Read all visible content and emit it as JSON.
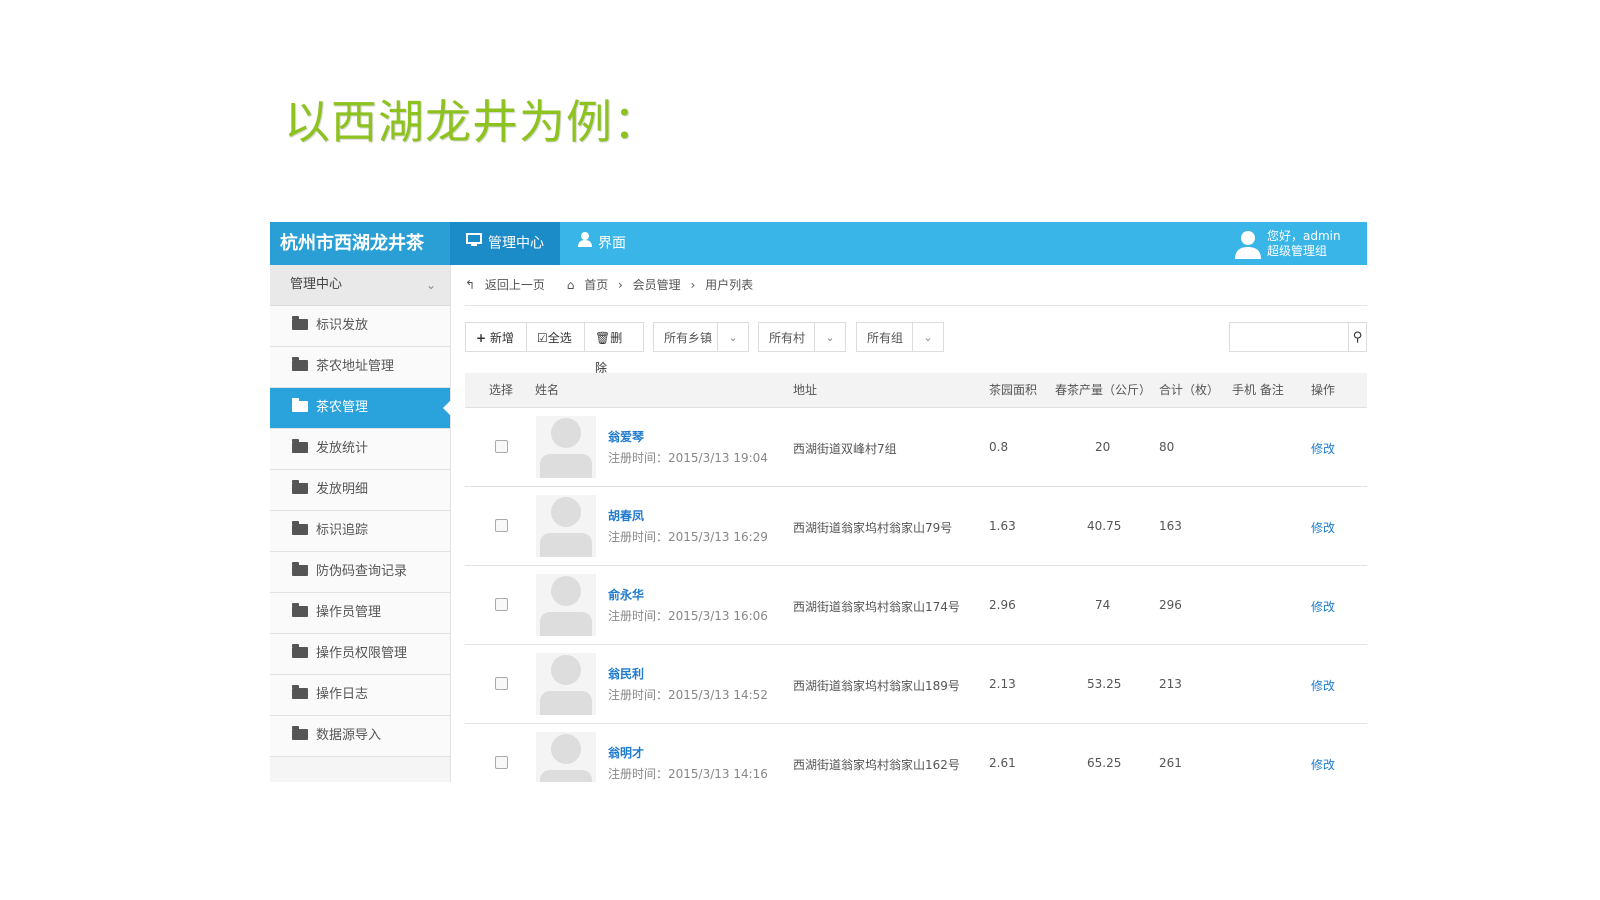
{
  "slide": {
    "title": "以西湖龙井为例："
  },
  "app": {
    "brand": "杭州市西湖龙井茶",
    "nav": [
      {
        "label": "管理中心",
        "icon": "monitor-icon",
        "active": true
      },
      {
        "label": "界面",
        "icon": "user-icon",
        "active": false
      }
    ],
    "user": {
      "greeting": "您好，admin",
      "role": "超级管理组"
    },
    "colors": {
      "topbar": "#3ab5e8",
      "brand_bg": "#2a9fd6",
      "active_tab": "#1c8cc9",
      "sidebar_active": "#2aa3dc",
      "link": "#1f7bd0",
      "title": "#8dc21f"
    }
  },
  "sidebar": {
    "header": "管理中心",
    "items": [
      {
        "label": "标识发放",
        "active": false
      },
      {
        "label": "茶农地址管理",
        "active": false
      },
      {
        "label": "茶农管理",
        "active": true
      },
      {
        "label": "发放统计",
        "active": false
      },
      {
        "label": "发放明细",
        "active": false
      },
      {
        "label": "标识追踪",
        "active": false
      },
      {
        "label": "防伪码查询记录",
        "active": false
      },
      {
        "label": "操作员管理",
        "active": false
      },
      {
        "label": "操作员权限管理",
        "active": false
      },
      {
        "label": "操作日志",
        "active": false
      },
      {
        "label": "数据源导入",
        "active": false
      }
    ]
  },
  "breadcrumb": {
    "back": "返回上一页",
    "home": "首页",
    "section": "会员管理",
    "current": "用户列表"
  },
  "toolbar": {
    "add": "新增",
    "select_all": "全选",
    "delete": "删除",
    "filters": [
      "所有乡镇",
      "所有村",
      "所有组"
    ],
    "search_placeholder": ""
  },
  "table": {
    "headers": {
      "select": "选择",
      "name": "姓名",
      "address": "地址",
      "area": "茶园面积",
      "yield": "春茶产量（公斤）",
      "total": "合计（枚）",
      "phone_note": "手机 备注",
      "action": "操作"
    },
    "rows": [
      {
        "name": "翁爱琴",
        "reg": "注册时间：2015/3/13 19:04",
        "address": "西湖街道双峰村7组",
        "area": "0.8",
        "yield": "20",
        "total": "80",
        "action": "修改"
      },
      {
        "name": "胡春凤",
        "reg": "注册时间：2015/3/13 16:29",
        "address": "西湖街道翁家坞村翁家山79号",
        "area": "1.63",
        "yield": "40.75",
        "total": "163",
        "action": "修改"
      },
      {
        "name": "俞永华",
        "reg": "注册时间：2015/3/13 16:06",
        "address": "西湖街道翁家坞村翁家山174号",
        "area": "2.96",
        "yield": "74",
        "total": "296",
        "action": "修改"
      },
      {
        "name": "翁民利",
        "reg": "注册时间：2015/3/13 14:52",
        "address": "西湖街道翁家坞村翁家山189号",
        "area": "2.13",
        "yield": "53.25",
        "total": "213",
        "action": "修改"
      },
      {
        "name": "翁明才",
        "reg": "注册时间：2015/3/13 14:16",
        "address": "西湖街道翁家坞村翁家山162号",
        "area": "2.61",
        "yield": "65.25",
        "total": "261",
        "action": "修改"
      }
    ]
  }
}
